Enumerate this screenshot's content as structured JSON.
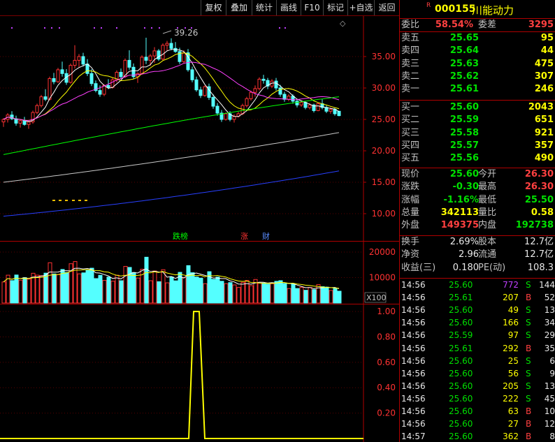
{
  "toolbar": {
    "buttons": [
      "复权",
      "叠加",
      "统计",
      "画线",
      "F10",
      "标记",
      "+自选",
      "返回"
    ]
  },
  "stock": {
    "marker": "R",
    "code": "000155",
    "name": "川能动力"
  },
  "order_ratio": {
    "label1": "委比",
    "value1": "58.54%",
    "label2": "委差",
    "value2": "3295"
  },
  "asks": [
    {
      "label": "卖五",
      "price": "25.65",
      "vol": "95"
    },
    {
      "label": "卖四",
      "price": "25.64",
      "vol": "44"
    },
    {
      "label": "卖三",
      "price": "25.63",
      "vol": "475"
    },
    {
      "label": "卖二",
      "price": "25.62",
      "vol": "307"
    },
    {
      "label": "卖一",
      "price": "25.61",
      "vol": "246"
    }
  ],
  "bids": [
    {
      "label": "买一",
      "price": "25.60",
      "vol": "2043"
    },
    {
      "label": "买二",
      "price": "25.59",
      "vol": "651"
    },
    {
      "label": "买三",
      "price": "25.58",
      "vol": "921"
    },
    {
      "label": "买四",
      "price": "25.57",
      "vol": "357"
    },
    {
      "label": "买五",
      "price": "25.56",
      "vol": "490"
    }
  ],
  "quote": [
    {
      "l1": "现价",
      "v1": "25.60",
      "c1": "green",
      "l2": "今开",
      "v2": "26.30",
      "c2": "red"
    },
    {
      "l1": "涨跌",
      "v1": "-0.30",
      "c1": "green",
      "l2": "最高",
      "v2": "26.30",
      "c2": "red"
    },
    {
      "l1": "涨幅",
      "v1": "-1.16%",
      "c1": "green",
      "l2": "最低",
      "v2": "25.50",
      "c2": "green"
    },
    {
      "l1": "总量",
      "v1": "342113",
      "c1": "yellow",
      "l2": "量比",
      "v2": "0.58",
      "c2": "yellow"
    },
    {
      "l1": "外盘",
      "v1": "149375",
      "c1": "red",
      "l2": "内盘",
      "v2": "192738",
      "c2": "green"
    }
  ],
  "stats": [
    {
      "l1": "换手",
      "v1": "2.69%",
      "l2": "股本",
      "v2": "12.7亿"
    },
    {
      "l1": "净资",
      "v1": "2.96",
      "l2": "流通",
      "v2": "12.7亿"
    },
    {
      "l1": "收益(三)",
      "v1": "0.180",
      "l2": "PE(动)",
      "v2": "108.3"
    }
  ],
  "ticks": [
    {
      "time": "14:56",
      "price": "25.60",
      "vol": "772",
      "side": "S",
      "n": "144",
      "vc": "purple"
    },
    {
      "time": "14:56",
      "price": "25.61",
      "vol": "207",
      "side": "B",
      "n": "52",
      "vc": "yellow"
    },
    {
      "time": "14:56",
      "price": "25.60",
      "vol": "49",
      "side": "S",
      "n": "13",
      "vc": "yellow"
    },
    {
      "time": "14:56",
      "price": "25.60",
      "vol": "166",
      "side": "S",
      "n": "34",
      "vc": "yellow"
    },
    {
      "time": "14:56",
      "price": "25.59",
      "vol": "97",
      "side": "S",
      "n": "29",
      "vc": "yellow"
    },
    {
      "time": "14:56",
      "price": "25.61",
      "vol": "292",
      "side": "B",
      "n": "35",
      "vc": "yellow"
    },
    {
      "time": "14:56",
      "price": "25.60",
      "vol": "25",
      "side": "S",
      "n": "6",
      "vc": "yellow"
    },
    {
      "time": "14:56",
      "price": "25.60",
      "vol": "56",
      "side": "S",
      "n": "9",
      "vc": "yellow"
    },
    {
      "time": "14:56",
      "price": "25.60",
      "vol": "205",
      "side": "S",
      "n": "13",
      "vc": "yellow"
    },
    {
      "time": "14:56",
      "price": "25.60",
      "vol": "222",
      "side": "S",
      "n": "45",
      "vc": "yellow"
    },
    {
      "time": "14:56",
      "price": "25.60",
      "vol": "63",
      "side": "B",
      "n": "10",
      "vc": "yellow"
    },
    {
      "time": "14:56",
      "price": "25.60",
      "vol": "27",
      "side": "B",
      "n": "12",
      "vc": "yellow"
    },
    {
      "time": "14:57",
      "price": "25.60",
      "vol": "362",
      "side": "B",
      "n": "8",
      "vc": "yellow"
    }
  ],
  "chart_data": {
    "type": "candlestick",
    "price_axis": {
      "min": 8,
      "max": 38,
      "ticks": [
        "35.00",
        "30.00",
        "25.00",
        "20.00",
        "15.00",
        "10.00"
      ]
    },
    "max_label": "39.26",
    "markers": [
      "跌榜",
      "涨",
      "财"
    ],
    "candles": [
      [
        24.6,
        25.2,
        23.8,
        25.0
      ],
      [
        25.0,
        26.0,
        24.5,
        25.7
      ],
      [
        25.7,
        26.3,
        24.9,
        25.1
      ],
      [
        25.1,
        25.6,
        24.0,
        24.4
      ],
      [
        24.4,
        25.0,
        23.7,
        24.8
      ],
      [
        24.8,
        25.4,
        24.0,
        24.2
      ],
      [
        24.2,
        24.8,
        23.5,
        24.6
      ],
      [
        24.6,
        26.4,
        24.3,
        26.1
      ],
      [
        26.1,
        27.5,
        25.8,
        27.2
      ],
      [
        27.2,
        28.9,
        26.9,
        28.6
      ],
      [
        28.6,
        29.8,
        27.9,
        28.2
      ],
      [
        28.2,
        31.8,
        28.0,
        31.5
      ],
      [
        31.5,
        32.4,
        30.6,
        31.0
      ],
      [
        31.0,
        33.2,
        30.8,
        32.9
      ],
      [
        32.9,
        34.2,
        31.8,
        32.3
      ],
      [
        32.3,
        33.0,
        30.5,
        30.9
      ],
      [
        30.9,
        33.9,
        30.7,
        33.6
      ],
      [
        33.6,
        36.8,
        33.1,
        34.4
      ],
      [
        34.4,
        35.4,
        33.3,
        35.0
      ],
      [
        35.0,
        35.6,
        33.4,
        33.8
      ],
      [
        33.8,
        34.6,
        31.9,
        32.3
      ],
      [
        32.3,
        33.0,
        30.3,
        30.7
      ],
      [
        30.7,
        31.2,
        29.3,
        29.6
      ],
      [
        29.6,
        30.4,
        28.6,
        29.0
      ],
      [
        29.0,
        30.6,
        28.7,
        30.4
      ],
      [
        30.4,
        31.4,
        29.8,
        30.1
      ],
      [
        30.1,
        31.6,
        29.9,
        31.3
      ],
      [
        31.3,
        32.8,
        30.9,
        32.5
      ],
      [
        32.5,
        33.1,
        31.5,
        31.8
      ],
      [
        31.8,
        34.7,
        31.6,
        34.4
      ],
      [
        34.4,
        36.0,
        32.9,
        33.3
      ],
      [
        33.3,
        33.9,
        31.4,
        31.8
      ],
      [
        31.8,
        32.5,
        30.8,
        32.3
      ],
      [
        32.3,
        35.2,
        32.1,
        34.9
      ],
      [
        34.9,
        38.0,
        33.8,
        34.4
      ],
      [
        34.4,
        35.4,
        33.5,
        35.1
      ],
      [
        35.1,
        36.5,
        34.0,
        35.9
      ],
      [
        35.9,
        36.2,
        34.3,
        34.6
      ],
      [
        34.6,
        37.1,
        34.4,
        36.8
      ],
      [
        36.8,
        37.5,
        35.9,
        37.1
      ],
      [
        37.1,
        37.9,
        36.0,
        36.3
      ],
      [
        36.3,
        37.3,
        35.6,
        35.8
      ],
      [
        35.8,
        36.4,
        33.8,
        34.2
      ],
      [
        34.2,
        36.0,
        34.0,
        35.6
      ],
      [
        35.6,
        36.2,
        32.6,
        32.9
      ],
      [
        32.9,
        33.4,
        30.9,
        31.3
      ],
      [
        31.3,
        31.8,
        29.4,
        29.7
      ],
      [
        29.7,
        30.2,
        28.4,
        28.8
      ],
      [
        28.8,
        30.4,
        28.6,
        30.2
      ],
      [
        30.2,
        30.7,
        28.1,
        28.5
      ],
      [
        28.5,
        29.0,
        26.7,
        27.1
      ],
      [
        27.1,
        27.6,
        25.6,
        26.0
      ],
      [
        26.0,
        26.5,
        24.6,
        25.0
      ],
      [
        25.0,
        26.1,
        24.8,
        25.9
      ],
      [
        25.9,
        26.3,
        24.7,
        25.0
      ],
      [
        25.0,
        25.8,
        24.5,
        25.5
      ],
      [
        25.5,
        26.2,
        25.3,
        25.9
      ],
      [
        25.9,
        27.5,
        25.7,
        27.2
      ],
      [
        27.2,
        28.6,
        26.9,
        28.3
      ],
      [
        28.3,
        29.6,
        28.0,
        29.3
      ],
      [
        29.3,
        30.4,
        28.6,
        29.9
      ],
      [
        29.9,
        31.7,
        29.6,
        31.4
      ],
      [
        31.4,
        32.1,
        30.7,
        31.2
      ],
      [
        31.2,
        31.6,
        29.8,
        30.3
      ],
      [
        30.3,
        31.4,
        30.0,
        31.1
      ],
      [
        31.1,
        31.6,
        29.6,
        30.0
      ],
      [
        30.0,
        30.5,
        28.6,
        29.0
      ],
      [
        29.0,
        29.4,
        27.8,
        28.2
      ],
      [
        28.2,
        29.0,
        27.9,
        28.7
      ],
      [
        28.7,
        29.0,
        27.5,
        27.9
      ],
      [
        27.9,
        28.2,
        26.9,
        27.3
      ],
      [
        27.3,
        28.0,
        27.0,
        27.7
      ],
      [
        27.7,
        27.9,
        26.6,
        26.9
      ],
      [
        26.9,
        27.6,
        26.6,
        27.3
      ],
      [
        27.3,
        27.5,
        26.1,
        26.4
      ],
      [
        26.4,
        27.7,
        26.3,
        27.5
      ],
      [
        27.5,
        28.2,
        26.6,
        26.9
      ],
      [
        26.9,
        27.2,
        26.0,
        26.3
      ],
      [
        26.3,
        26.9,
        25.9,
        26.6
      ],
      [
        26.6,
        26.8,
        25.6,
        25.9
      ],
      [
        26.3,
        26.3,
        25.5,
        25.6
      ]
    ],
    "volume_axis": {
      "ticks": [
        "20000",
        "10000"
      ],
      "unit": "X100"
    },
    "indicator_axis": {
      "ticks": [
        "1.00",
        "0.80",
        "0.60",
        "0.40",
        "0.20"
      ],
      "min": 0,
      "max": 1.05
    },
    "colors": {
      "up": "#ff3232",
      "down": "#54ffff",
      "ma5": "#ffffff",
      "ma10": "#ffff00",
      "ma20": "#ff40ff",
      "ma60": "#00ff00",
      "ma120": "#c8c8c8",
      "ma250": "#2840ff"
    }
  }
}
